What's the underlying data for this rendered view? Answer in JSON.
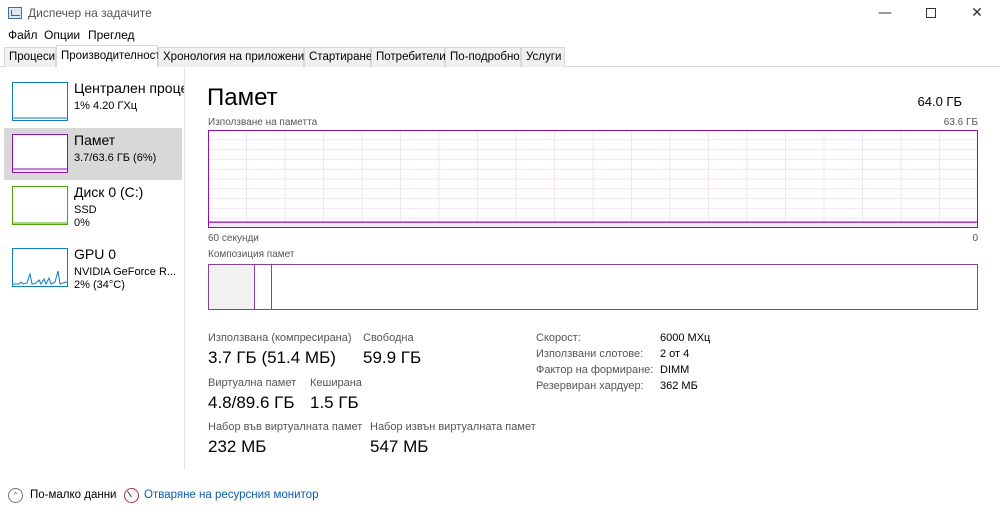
{
  "window": {
    "title": "Диспечер на задачите",
    "icon": "task-manager-icon",
    "minimize_glyph": "—",
    "close_glyph": "✕"
  },
  "menu": [
    "Файл",
    "Опции",
    "Преглед"
  ],
  "tabs": [
    {
      "label": "Процеси",
      "active": false
    },
    {
      "label": "Производителност",
      "active": true
    },
    {
      "label": "Хронология на приложение",
      "active": false
    },
    {
      "label": "Стартиране",
      "active": false
    },
    {
      "label": "Потребители",
      "active": false
    },
    {
      "label": "По-подробно",
      "active": false
    },
    {
      "label": "Услуги",
      "active": false
    }
  ],
  "sidebar": {
    "items": [
      {
        "title": "Централен процесор",
        "line1": "1% 4.20 ГХц",
        "line2": "",
        "color": "#117dbb"
      },
      {
        "title": "Памет",
        "line1": "3.7/63.6 ГБ (6%)",
        "line2": "",
        "color": "#8b12ae",
        "selected": true
      },
      {
        "title": "Диск 0 (C:)",
        "line1": "SSD",
        "line2": "0%",
        "color": "#4da60c"
      },
      {
        "title": "GPU 0",
        "line1": "NVIDIA GeForce R...",
        "line2": "2% (34°C)",
        "color": "#117dbb"
      }
    ]
  },
  "main": {
    "title": "Памет",
    "total": "64.0 ГБ",
    "graph_label": "Използване на паметта",
    "graph_max": "63.6 ГБ",
    "axis_left": "60 секунди",
    "axis_right": "0",
    "composition_label": "Композиция памет",
    "composition": {
      "in_use_fraction": 0.06,
      "modified_fraction": 0.022
    },
    "usage_fraction": 0.06,
    "accent_color": "#8b12ae",
    "stats": {
      "in_use_label": "Използвана (компресирана)",
      "in_use_value": "3.7 ГБ (51.4 МБ)",
      "available_label": "Свободна",
      "available_value": "59.9 ГБ",
      "committed_label": "Виртуална памет",
      "committed_value": "4.8/89.6 ГБ",
      "cached_label": "Кеширана",
      "cached_value": "1.5 ГБ",
      "paged_label": "Набор във виртуалната памет",
      "paged_value": "232 МБ",
      "nonpaged_label": "Набор извън виртуалната памет",
      "nonpaged_value": "547 МБ"
    },
    "details": [
      {
        "key": "Скорост:",
        "value": "6000 МХц"
      },
      {
        "key": "Използвани слотове:",
        "value": "2 от 4"
      },
      {
        "key": "Фактор на формиране:",
        "value": "DIMM"
      },
      {
        "key": "Резервиран хардуер:",
        "value": "362 МБ"
      }
    ]
  },
  "footer": {
    "fewer_details": "По-малко данни",
    "fewer_icon_glyph": "⌃",
    "resource_monitor": "Отваряне на ресурсния монитор"
  }
}
